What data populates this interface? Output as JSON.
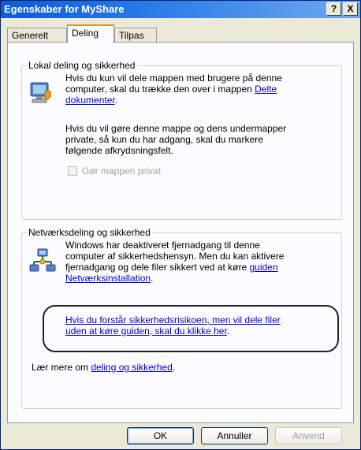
{
  "window": {
    "title": "Egenskaber for MyShare",
    "help_glyph": "?",
    "close_glyph": "X"
  },
  "tabs": [
    {
      "label": "Generelt"
    },
    {
      "label": "Deling"
    },
    {
      "label": "Tilpas"
    }
  ],
  "local": {
    "title": "Lokal deling og sikkerhed",
    "para1_line1": "Hvis du kun vil dele mappen med brugere på denne",
    "para1_line2_pre": "computer, skal du trække den over i mappen ",
    "para1_link_a": "Delte",
    "para1_link_b": "dokumenter",
    "para1_end": ".",
    "para2_line1": "Hvis du vil gøre denne mappe og dens undermapper",
    "para2_line2": "private, så kun du har adgang, skal du markere",
    "para2_line3": "følgende afkrydsningsfelt.",
    "checkbox_label": "Gør mappen privat",
    "icon": "network-computer-icon"
  },
  "network": {
    "title": "Netværksdeling og sikkerhed",
    "line1": "Windows har deaktiveret fjernadgang til denne",
    "line2": "computer af sikkerhedshensyn. Men du kan aktivere",
    "line3_pre": "fjernadgang og dele filer sikkert ved at køre ",
    "line3_link": "guiden",
    "line4_link": "Netværksinstallation",
    "line4_end": ".",
    "risk_link_line1": "Hvis du forstår sikkerhedsrisikoen, men vil dele filer",
    "risk_link_line2": "uden at køre guiden, skal du klikke her",
    "risk_end": ".",
    "learn_pre": "Lær mere om ",
    "learn_link": "deling og sikkerhed",
    "learn_end": ".",
    "icon": "network-share-icon"
  },
  "buttons": {
    "ok": "OK",
    "cancel": "Annuller",
    "apply": "Anvend"
  }
}
